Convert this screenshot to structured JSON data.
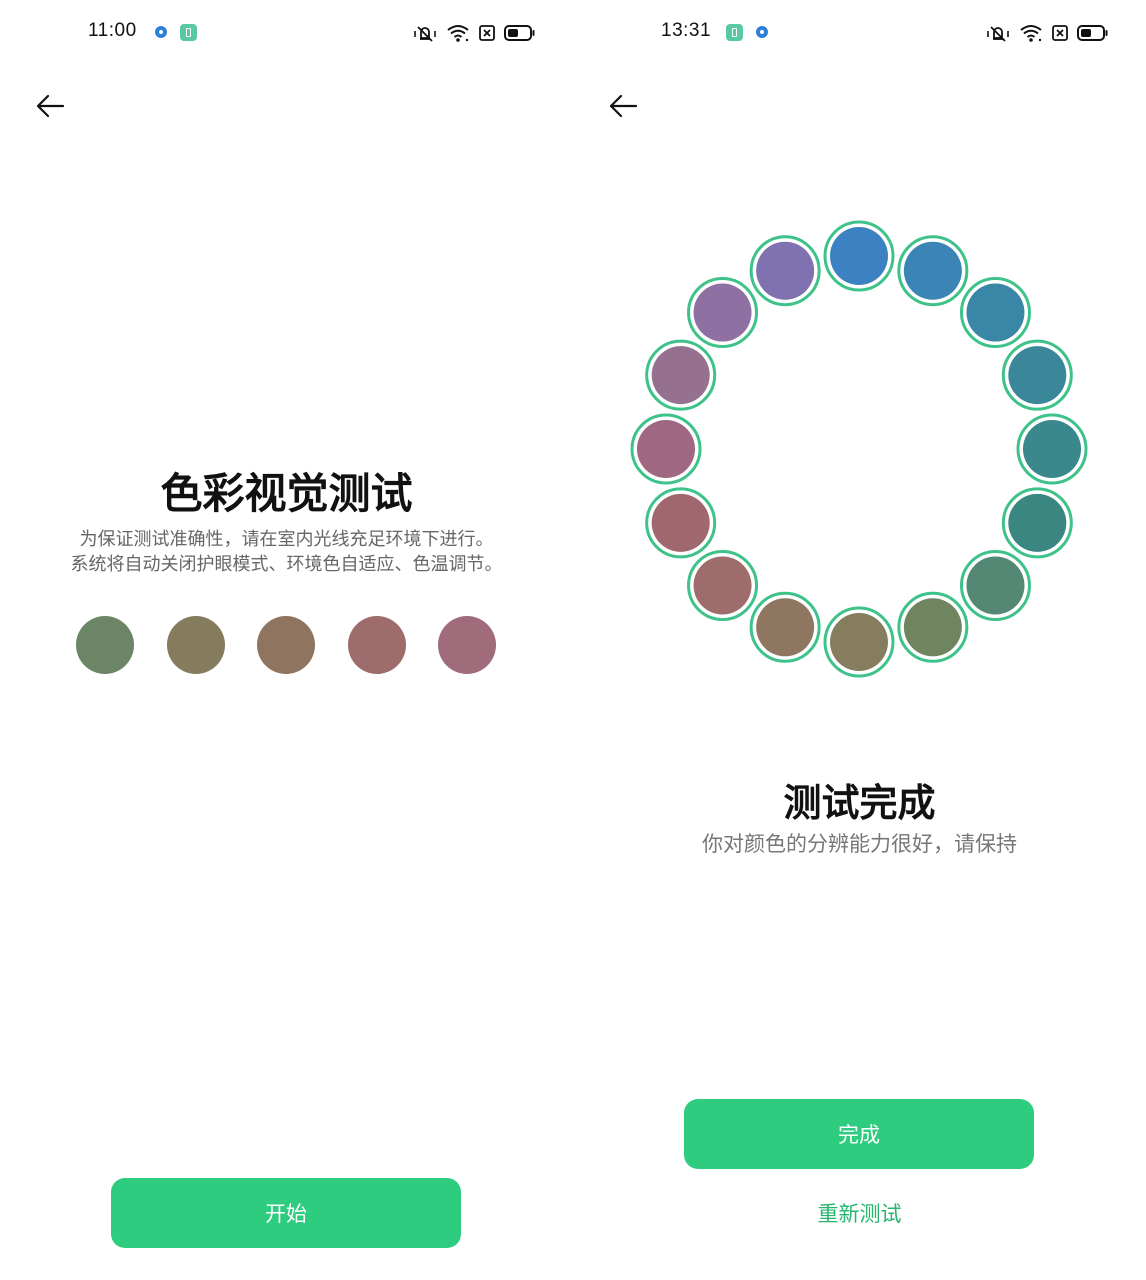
{
  "left_screen": {
    "status_bar": {
      "time": "11:00"
    },
    "title": "色彩视觉测试",
    "description_line1": "为保证测试准确性，请在室内光线充足环境下进行。",
    "description_line2": "系统将自动关闭护眼模式、环境色自适应、色温调节。",
    "swatches": [
      "#6b8566",
      "#857c5e",
      "#8f7560",
      "#9e6d6b",
      "#a06b7b"
    ],
    "start_button_label": "开始"
  },
  "right_screen": {
    "status_bar": {
      "time": "13:31"
    },
    "ring_colors": [
      "#3c82c2",
      "#3a85b5",
      "#3a86a6",
      "#3a879a",
      "#3a878c",
      "#3a8680",
      "#548774",
      "#6e8560",
      "#857d5e",
      "#8e7660",
      "#9e6d6b",
      "#a0686e",
      "#9f6781",
      "#95708f",
      "#8e70a2",
      "#8072b0"
    ],
    "ring_border_color": "#3ec28a",
    "title": "测试完成",
    "result_text": "你对颜色的分辨能力很好，请保持",
    "done_button_label": "完成",
    "retest_label": "重新测试"
  },
  "colors": {
    "accent": "#2ecc7f",
    "accent_text": "#27b56d"
  }
}
